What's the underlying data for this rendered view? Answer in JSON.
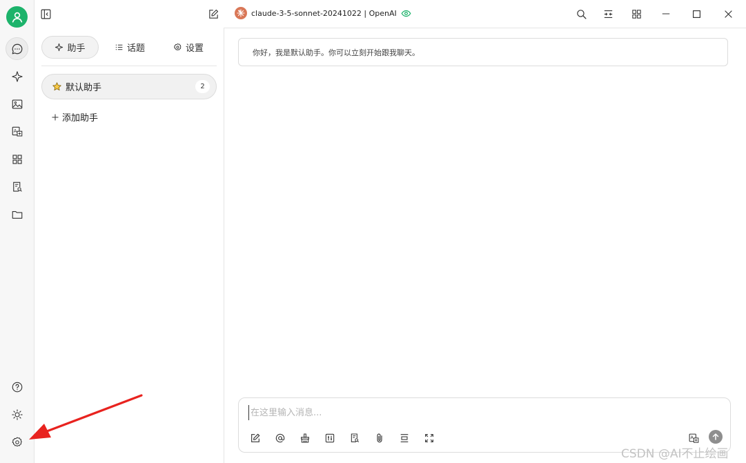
{
  "rail": {
    "icons": [
      "user-icon",
      "chat-bubble-icon",
      "sparkle-icon",
      "image-icon",
      "translate-icon",
      "apps-grid-icon",
      "document-search-icon",
      "folder-icon",
      "help-icon",
      "sun-icon",
      "gear-icon"
    ]
  },
  "header": {
    "model_name": "claude-3-5-sonnet-20241022 | OpenAI"
  },
  "sidebar": {
    "tabs": [
      {
        "label": "助手",
        "active": true
      },
      {
        "label": "话题",
        "active": false
      },
      {
        "label": "设置",
        "active": false
      }
    ],
    "assistant": {
      "name": "默认助手",
      "count": "2"
    },
    "add_label": "添加助手"
  },
  "chat": {
    "greeting": "你好，我是默认助手。你可以立刻开始跟我聊天。"
  },
  "composer": {
    "placeholder": "在这里输入消息..."
  },
  "watermark": "CSDN @AI不止绘画",
  "colors": {
    "accent": "#1db36b",
    "claude": "#d97757",
    "arrow": "#e8231f"
  }
}
